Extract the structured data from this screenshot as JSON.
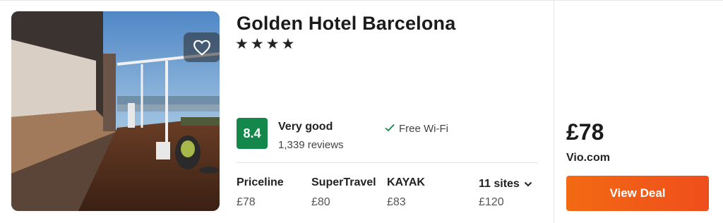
{
  "hotel": {
    "name": "Golden Hotel Barcelona",
    "stars": "★★★★",
    "score": "8.4",
    "rating_label": "Very good",
    "reviews": "1,339 reviews",
    "amenity": "Free Wi-Fi"
  },
  "sites": [
    {
      "name": "Priceline",
      "price": "£78"
    },
    {
      "name": "SuperTravel",
      "price": "£80"
    },
    {
      "name": "KAYAK",
      "price": "£83"
    }
  ],
  "more_sites": {
    "label": "11 sites",
    "price": "£120"
  },
  "best_deal": {
    "price": "£78",
    "provider": "Vio.com",
    "button_label": "View Deal"
  },
  "colors": {
    "score_bg": "#14884a",
    "deal_button": "#f05a18"
  },
  "icons": {
    "favorite": "heart-outline-icon",
    "amenity": "checkmark-icon",
    "expand": "chevron-down-icon"
  }
}
